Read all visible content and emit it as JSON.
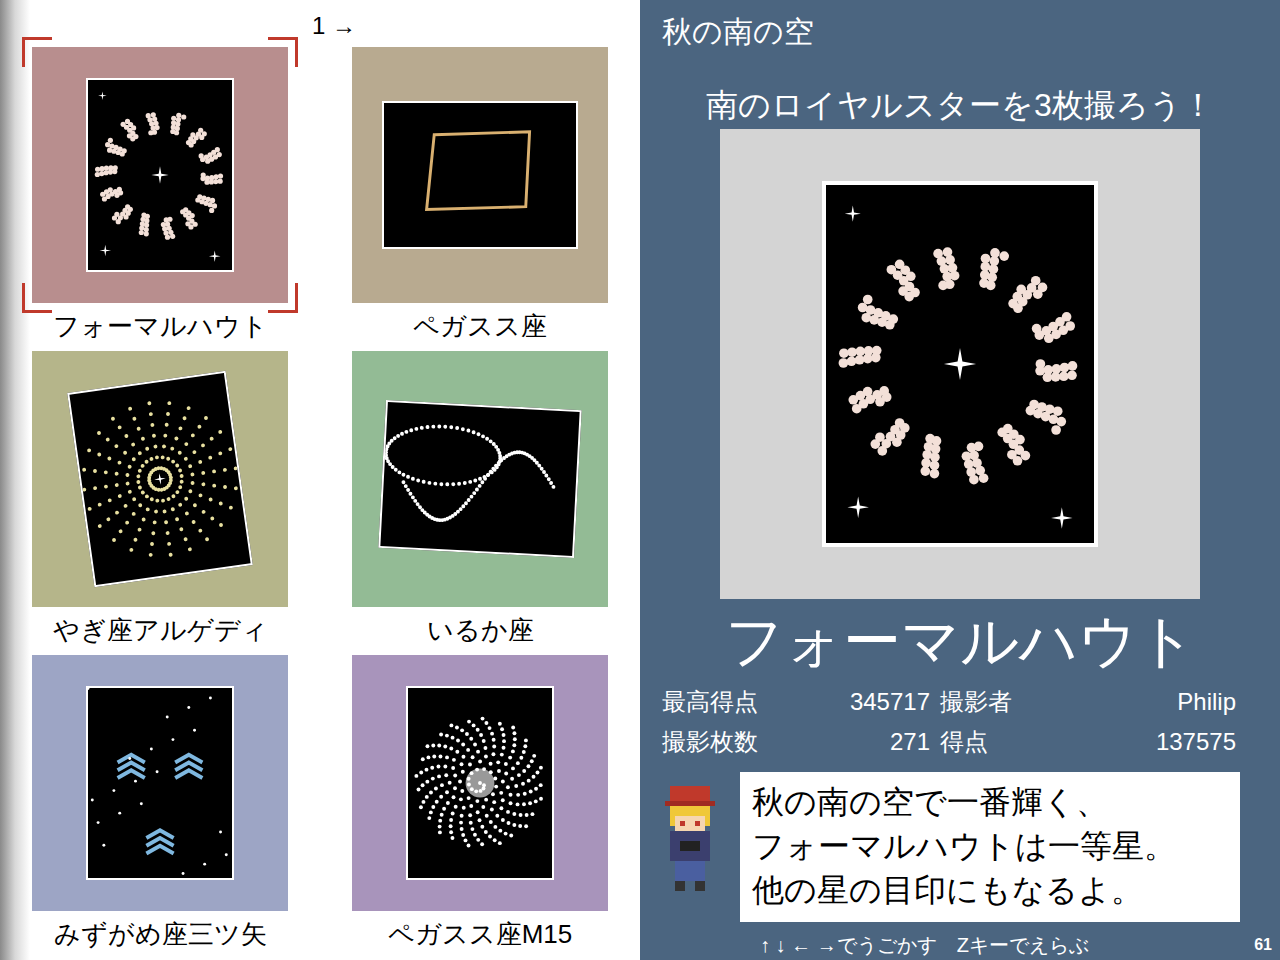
{
  "page_indicator": "1 →",
  "cards": [
    {
      "label": "フォーマルハウト",
      "selected": true,
      "color": "#b88e8e",
      "kind": "ring"
    },
    {
      "label": "ペガスス座",
      "selected": false,
      "color": "#b8aa90",
      "kind": "square"
    },
    {
      "label": "やぎ座アルゲディ",
      "selected": false,
      "color": "#b5b58a",
      "kind": "rays"
    },
    {
      "label": "いるか座",
      "selected": false,
      "color": "#93bb95",
      "kind": "curve"
    },
    {
      "label": "みずがめ座三ツ矢",
      "selected": false,
      "color": "#9da5c5",
      "kind": "arrows"
    },
    {
      "label": "ペガスス座M15",
      "selected": false,
      "color": "#a894bb",
      "kind": "spiral"
    }
  ],
  "detail": {
    "heading": "秋の南の空",
    "mission": "南のロイヤルスターを3枚撮ろう！",
    "name": "フォーマルハウト",
    "kind": "ring",
    "stats": [
      {
        "label": "最高得点",
        "value": "345717"
      },
      {
        "label": "撮影者",
        "value": "Philip"
      },
      {
        "label": "撮影枚数",
        "value": "271"
      },
      {
        "label": "得点",
        "value": "137575"
      }
    ],
    "message": [
      "秋の南の空で一番輝く、",
      "フォーマルハウトは一等星。",
      "他の星の目印にもなるよ。"
    ]
  },
  "footer": {
    "controls": "↑ ↓ ← →でうごかす",
    "select": "Zキーでえらぶ",
    "page": "61"
  }
}
